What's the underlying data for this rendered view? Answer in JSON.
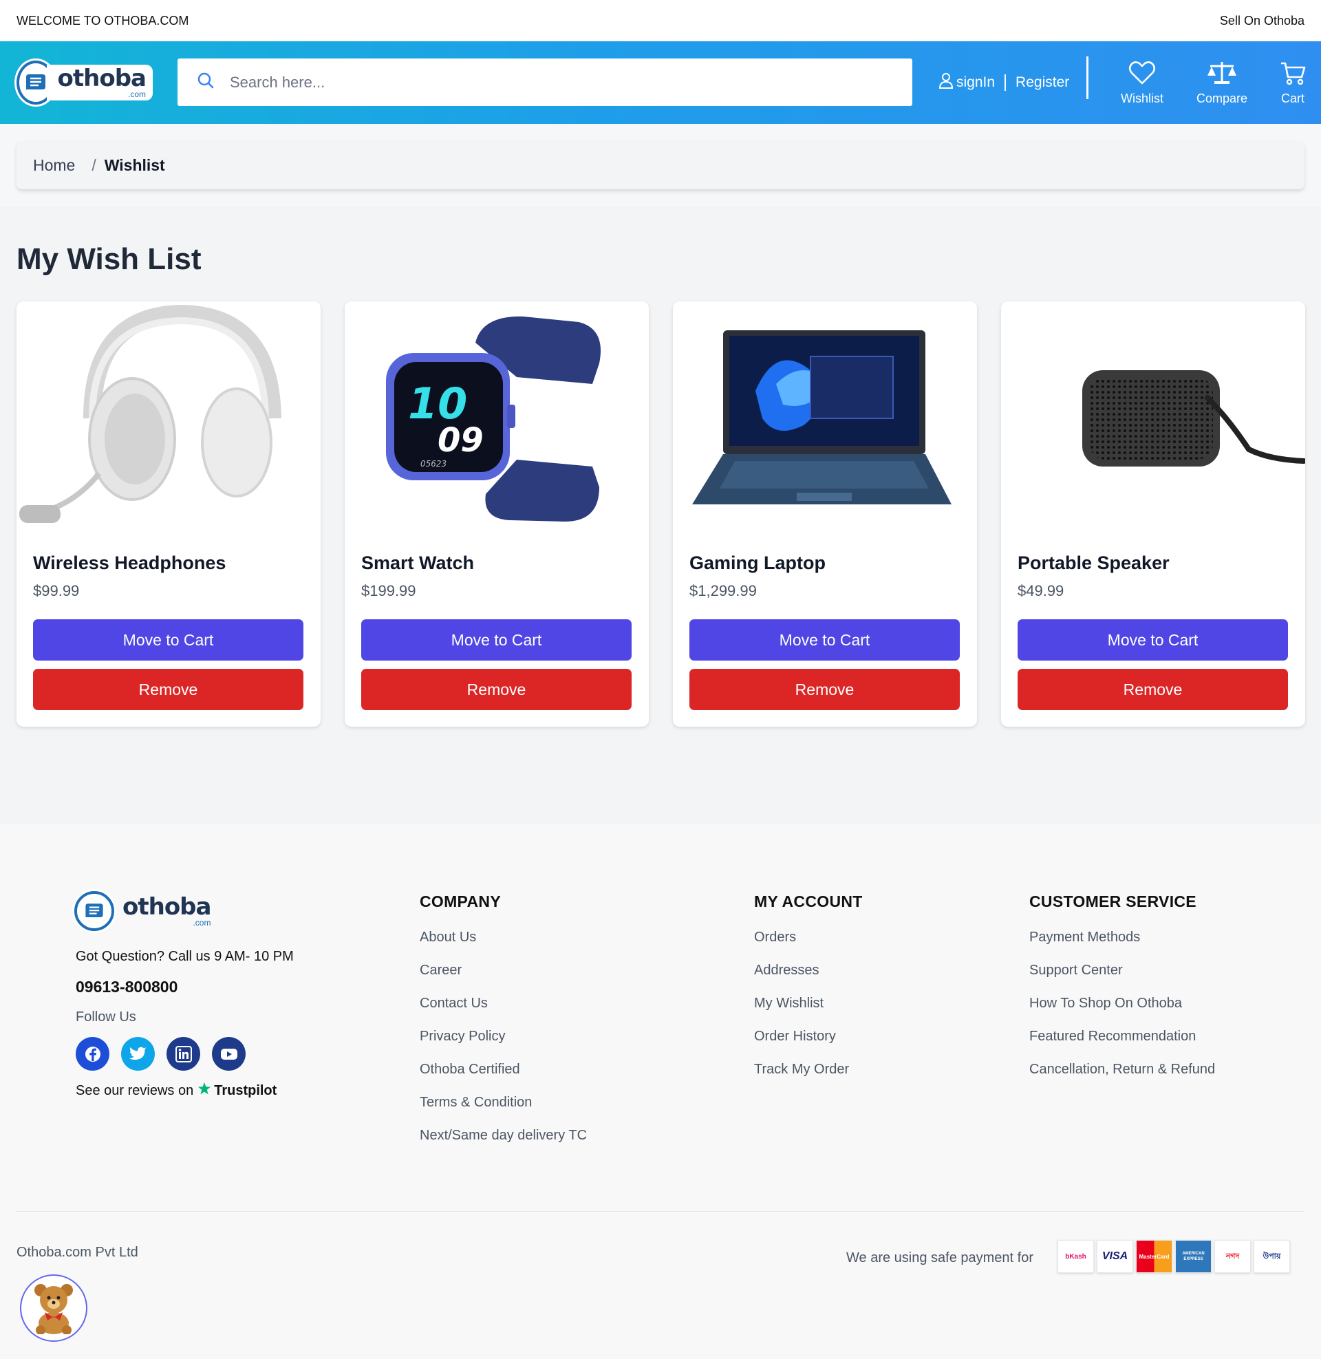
{
  "topbar": {
    "welcome": "WELCOME TO OTHOBA.COM",
    "sell": "Sell On Othoba"
  },
  "brand": {
    "name": "othoba",
    "suffix": ".com"
  },
  "header": {
    "search_placeholder": "Search here...",
    "signin": "signIn",
    "register": "Register",
    "wishlist": "Wishlist",
    "compare": "Compare",
    "cart": "Cart"
  },
  "breadcrumb": {
    "home": "Home",
    "separator": "/",
    "current": "Wishlist"
  },
  "page": {
    "title": "My Wish List"
  },
  "buttons": {
    "move_to_cart": "Move to Cart",
    "remove": "Remove"
  },
  "products": [
    {
      "name": "Wireless Headphones",
      "price": "$99.99",
      "image": "headphones"
    },
    {
      "name": "Smart Watch",
      "price": "$199.99",
      "image": "smart-watch"
    },
    {
      "name": "Gaming Laptop",
      "price": "$1,299.99",
      "image": "laptop"
    },
    {
      "name": "Portable Speaker",
      "price": "$49.99",
      "image": "speaker"
    }
  ],
  "footer": {
    "question": "Got Question? Call us 9 AM- 10 PM",
    "phone": "09613-800800",
    "follow": "Follow Us",
    "socials": [
      "facebook-icon",
      "twitter-icon",
      "linkedin-icon",
      "youtube-icon"
    ],
    "reviews": "See our reviews on",
    "trustpilot": "Trustpilot",
    "company": {
      "title": "COMPANY",
      "links": [
        "About Us",
        "Career",
        "Contact Us",
        "Privacy Policy",
        "Othoba Certified",
        "Terms & Condition",
        "Next/Same day delivery TC"
      ]
    },
    "account": {
      "title": "MY ACCOUNT",
      "links": [
        "Orders",
        "Addresses",
        "My Wishlist",
        "Order History",
        "Track My Order"
      ]
    },
    "service": {
      "title": "CUSTOMER SERVICE",
      "links": [
        "Payment Methods",
        "Support Center",
        "How To Shop On Othoba",
        "Featured Recommendation",
        "Cancellation, Return & Refund"
      ]
    },
    "copyright": "Othoba.com Pvt Ltd",
    "payment_label": "We are using safe payment for",
    "payments": [
      "bKash",
      "VISA",
      "MasterCard",
      "AMERICAN EXPRESS",
      "নগদ",
      "উপায়"
    ]
  },
  "colors": {
    "primary": "#4f46e5",
    "danger": "#dc2626",
    "header_start": "#13b5d6",
    "header_end": "#2f8ff0"
  }
}
